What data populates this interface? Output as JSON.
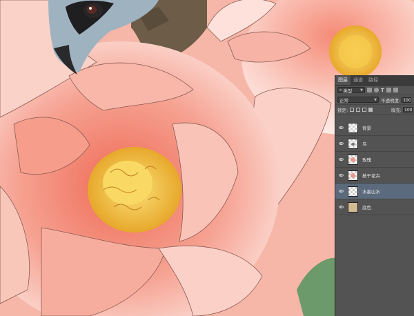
{
  "panel": {
    "tabs": [
      "图层",
      "通道",
      "路径"
    ],
    "kind_filter": "类型",
    "blend_mode": "正常",
    "opacity_label": "不透明度:",
    "opacity_value": "100%",
    "lock_label": "锁定:",
    "fill_label": "填充:",
    "fill_value": "100%",
    "filter_icons": [
      "image-filter-icon",
      "adjustment-filter-icon",
      "type-filter-icon",
      "shape-filter-icon",
      "smart-object-filter-icon"
    ],
    "type_icon_glyph": "T"
  },
  "layers": [
    {
      "name": "背景",
      "visible": true,
      "selected": false,
      "thumb": "transparent"
    },
    {
      "name": "鸟",
      "visible": true,
      "selected": false,
      "thumb": "bird"
    },
    {
      "name": "玫瑰",
      "visible": true,
      "selected": false,
      "thumb": "flower"
    },
    {
      "name": "枝干花卉",
      "visible": true,
      "selected": false,
      "thumb": "flower"
    },
    {
      "name": "水墨山水",
      "visible": true,
      "selected": true,
      "thumb": "transparent"
    },
    {
      "name": "底色",
      "visible": true,
      "selected": false,
      "thumb": "solid",
      "color": "#d1bc92"
    }
  ],
  "colors": {
    "petal": "#f4a595",
    "petal_light": "#fde7e1",
    "stamen": "#f3c23a",
    "background": "#6d5d48",
    "leaf": "#6c9a6a"
  }
}
